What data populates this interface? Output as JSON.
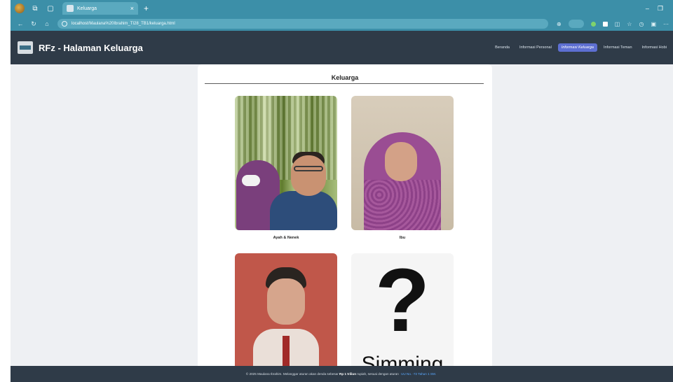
{
  "browser": {
    "tab_title": "Keluarga",
    "url_host": "localhost",
    "url_path": "/Maulana%20Ibrahim_TI28_TB1/keluarga.html"
  },
  "site": {
    "title": "RFz - Halaman Keluarga",
    "nav": [
      {
        "label": "Beranda",
        "active": false
      },
      {
        "label": "Informasi Personal",
        "active": false
      },
      {
        "label": "Informasi Keluarga",
        "active": true
      },
      {
        "label": "Informasi Teman",
        "active": false
      },
      {
        "label": "Informasi Hobi",
        "active": false
      }
    ]
  },
  "main": {
    "heading": "Keluarga",
    "members": [
      {
        "caption": "Ayah & Nenek"
      },
      {
        "caption": "Ibu"
      },
      {
        "caption": ""
      },
      {
        "caption": ""
      }
    ],
    "unknown_photo": {
      "symbol": "?",
      "text": "Simming"
    }
  },
  "footer": {
    "prefix": "© 2025 Maulana Ibrahim. Melanggar aturan akan denda sebesar",
    "amount": "Rp 1 triliun",
    "middle": "rupiah, sesuai dengan aturan",
    "law": "UU No. -72 Tahun 1 SM."
  }
}
